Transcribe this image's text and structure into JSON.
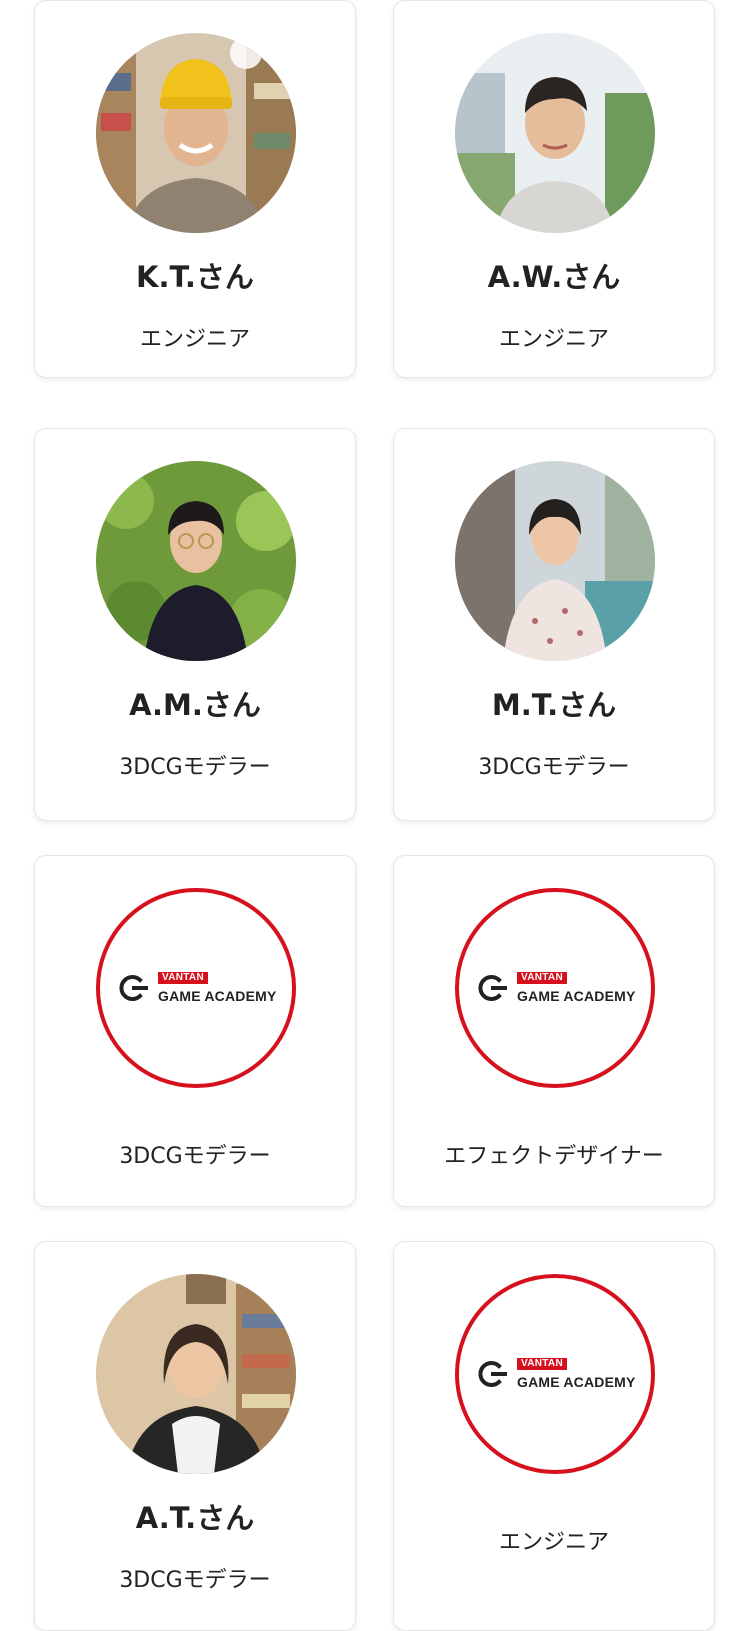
{
  "colors": {
    "accent_red": "#d6101c",
    "card_border": "#e6e6e6",
    "text": "#222222"
  },
  "logo": {
    "tag": "VANTAN",
    "name": "GAME ACADEMY",
    "mark_icon": "game-academy-g-icon"
  },
  "cards": [
    {
      "name": "K.T.さん",
      "role": "エンジニア",
      "image": "photo"
    },
    {
      "name": "A.W.さん",
      "role": "エンジニア",
      "image": "photo"
    },
    {
      "name": "A.M.さん",
      "role": "3DCGモデラー",
      "image": "photo"
    },
    {
      "name": "M.T.さん",
      "role": "3DCGモデラー",
      "image": "photo"
    },
    {
      "role": "3DCGモデラー",
      "image": "logo"
    },
    {
      "role": "エフェクトデザイナー",
      "image": "logo"
    },
    {
      "name": "A.T.さん",
      "role": "3DCGモデラー",
      "image": "photo"
    },
    {
      "role": "エンジニア",
      "image": "logo"
    }
  ]
}
